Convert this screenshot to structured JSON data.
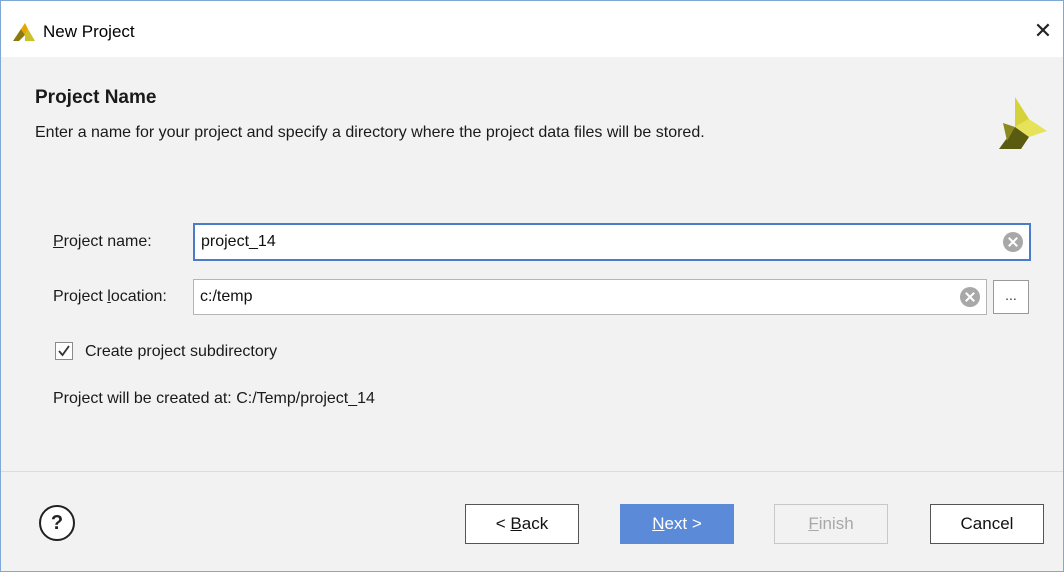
{
  "window": {
    "title": "New Project",
    "close_glyph": "✕",
    "icon": "vivado-logo-icon"
  },
  "header": {
    "title": "Project Name",
    "description": "Enter a name for your project and specify a directory where the project data files will be stored."
  },
  "form": {
    "project_name": {
      "label_ul": "P",
      "label_rest": "roject name:",
      "value": "project_14"
    },
    "project_location": {
      "label_pre": "Project ",
      "label_ul": "l",
      "label_rest": "ocation:",
      "value": "c:/temp",
      "browse_label": "..."
    },
    "create_subdirectory": {
      "label": "Create project subdirectory",
      "checked": true
    },
    "result_text": "Project will be created at: C:/Temp/project_14"
  },
  "footer": {
    "help_label": "?",
    "back": {
      "pre": "< ",
      "ul": "B",
      "rest": "ack"
    },
    "next": {
      "ul": "N",
      "rest": "ext >"
    },
    "finish": {
      "ul": "F",
      "rest": "inish"
    },
    "cancel": "Cancel"
  },
  "colors": {
    "accent": "#5b8ad8",
    "focus_border": "#4a7cc9",
    "panel_bg": "#f2f2f2"
  }
}
